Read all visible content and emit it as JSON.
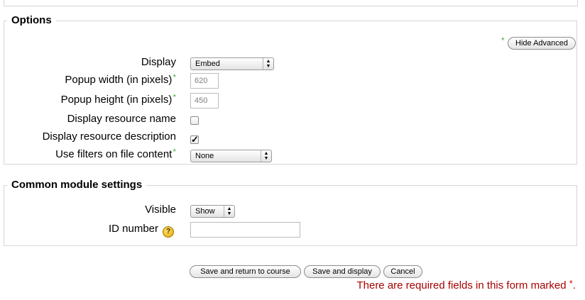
{
  "options": {
    "legend": "Options",
    "advanced_marker": "*",
    "hide_advanced_label": "Hide Advanced",
    "display_label": "Display",
    "display_value": "Embed",
    "popup_width_label": "Popup width (in pixels)",
    "popup_width_value": "620",
    "popup_height_label": "Popup height (in pixels)",
    "popup_height_value": "450",
    "show_name_label": "Display resource name",
    "show_name_checked": false,
    "show_desc_label": "Display resource description",
    "show_desc_checked": true,
    "filters_label": "Use filters on file content",
    "filters_value": "None",
    "required_marker": "*"
  },
  "common": {
    "legend": "Common module settings",
    "visible_label": "Visible",
    "visible_value": "Show",
    "idnumber_label": "ID number",
    "idnumber_value": "",
    "help_icon_glyph": "?"
  },
  "buttons": {
    "save_return": "Save and return to course",
    "save_display": "Save and display",
    "cancel": "Cancel"
  },
  "footer": {
    "required_note": "There are required fields in this form marked",
    "required_star": "*",
    "period": "."
  }
}
